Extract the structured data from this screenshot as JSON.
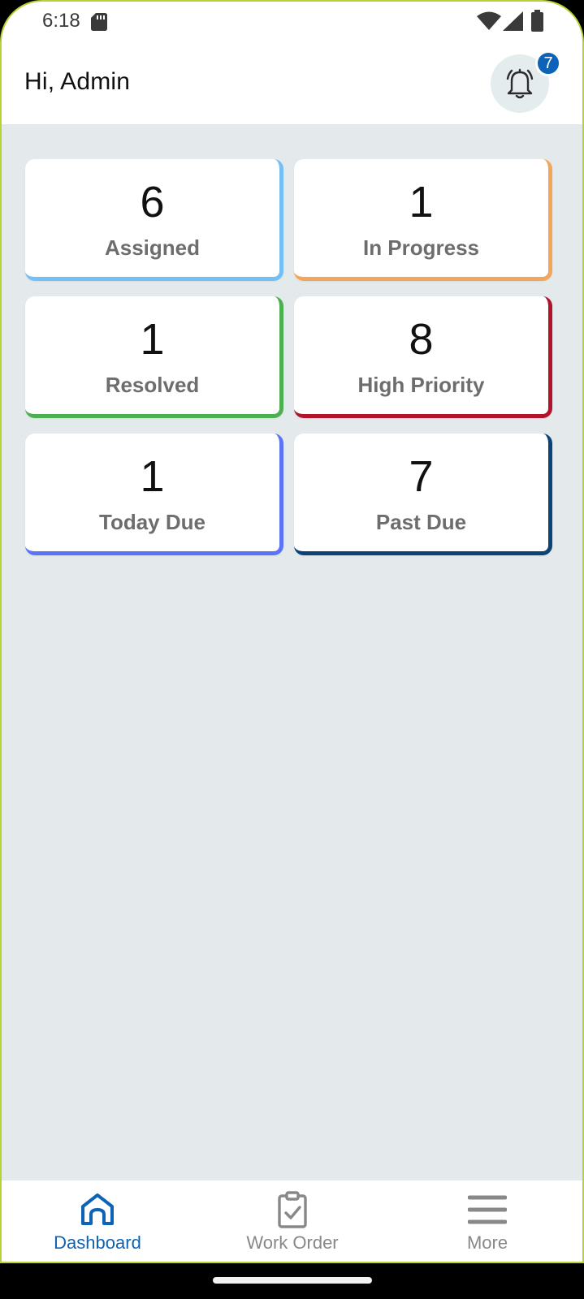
{
  "status_bar": {
    "time": "6:18",
    "icons": [
      "sd-card-icon",
      "wifi-icon",
      "signal-icon",
      "battery-icon"
    ]
  },
  "header": {
    "greeting": "Hi, Admin",
    "notification_icon": "bell-icon",
    "notification_count": "7"
  },
  "cards": [
    {
      "value": "6",
      "label": "Assigned",
      "accent": "#74bff6"
    },
    {
      "value": "1",
      "label": "In Progress",
      "accent": "#f3a55a"
    },
    {
      "value": "1",
      "label": "Resolved",
      "accent": "#4caf50"
    },
    {
      "value": "8",
      "label": "High Priority",
      "accent": "#b3122b"
    },
    {
      "value": "1",
      "label": "Today Due",
      "accent": "#5b73f6"
    },
    {
      "value": "7",
      "label": "Past Due",
      "accent": "#0b4379"
    }
  ],
  "bottom_nav": {
    "items": [
      {
        "label": "Dashboard",
        "icon": "home-icon",
        "active": true
      },
      {
        "label": "Work Order",
        "icon": "clipboard-check-icon",
        "active": false
      },
      {
        "label": "More",
        "icon": "menu-icon",
        "active": false
      }
    ]
  },
  "colors": {
    "primary": "#0d63b7",
    "background": "#e4eaec",
    "device_frame": "#b5d334"
  }
}
